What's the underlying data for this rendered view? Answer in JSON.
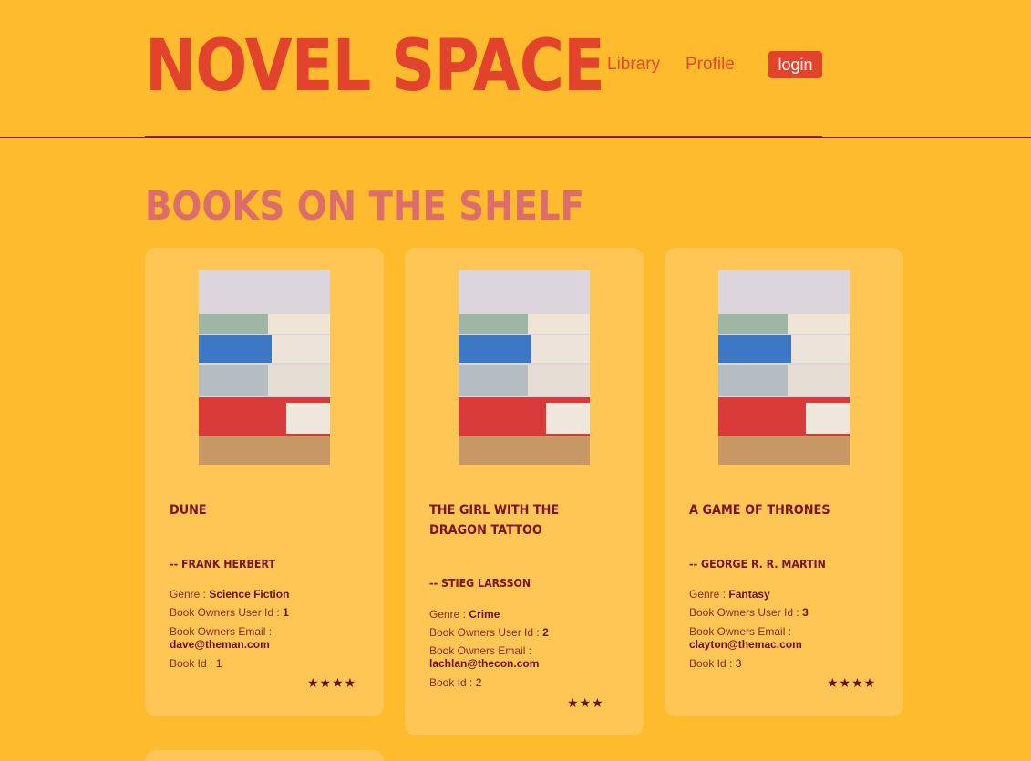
{
  "header": {
    "logo": "NOVEL SPACE",
    "nav": {
      "library": "Library",
      "profile": "Profile"
    },
    "login_label": "login"
  },
  "section_title": "BOOKS ON THE SHELF",
  "labels": {
    "genre": "Genre :",
    "owner_id": "Book Owners User Id :",
    "owner_email": "Book Owners Email :",
    "book_id": "Book Id :"
  },
  "books": [
    {
      "title": "DUNE",
      "author": "-- FRANK HERBERT",
      "genre": "Science Fiction",
      "owner_id": "1",
      "owner_email": "dave@theman.com",
      "book_id": "1",
      "rating": 4,
      "stars": "★★★★"
    },
    {
      "title": "THE GIRL WITH THE DRAGON TATTOO",
      "author": "-- STIEG LARSSON",
      "genre": "Crime",
      "owner_id": "2",
      "owner_email": "lachlan@thecon.com",
      "book_id": "2",
      "rating": 3,
      "stars": "★★★"
    },
    {
      "title": "A GAME OF THRONES",
      "author": "-- GEORGE R. R. MARTIN",
      "genre": "Fantasy",
      "owner_id": "3",
      "owner_email": "clayton@themac.com",
      "book_id": "3",
      "rating": 4,
      "stars": "★★★★"
    }
  ],
  "colors": {
    "background": "#FEBB2E",
    "card": "#FEC654",
    "brand": "#E2432C",
    "accent_text": "#7A1527"
  }
}
